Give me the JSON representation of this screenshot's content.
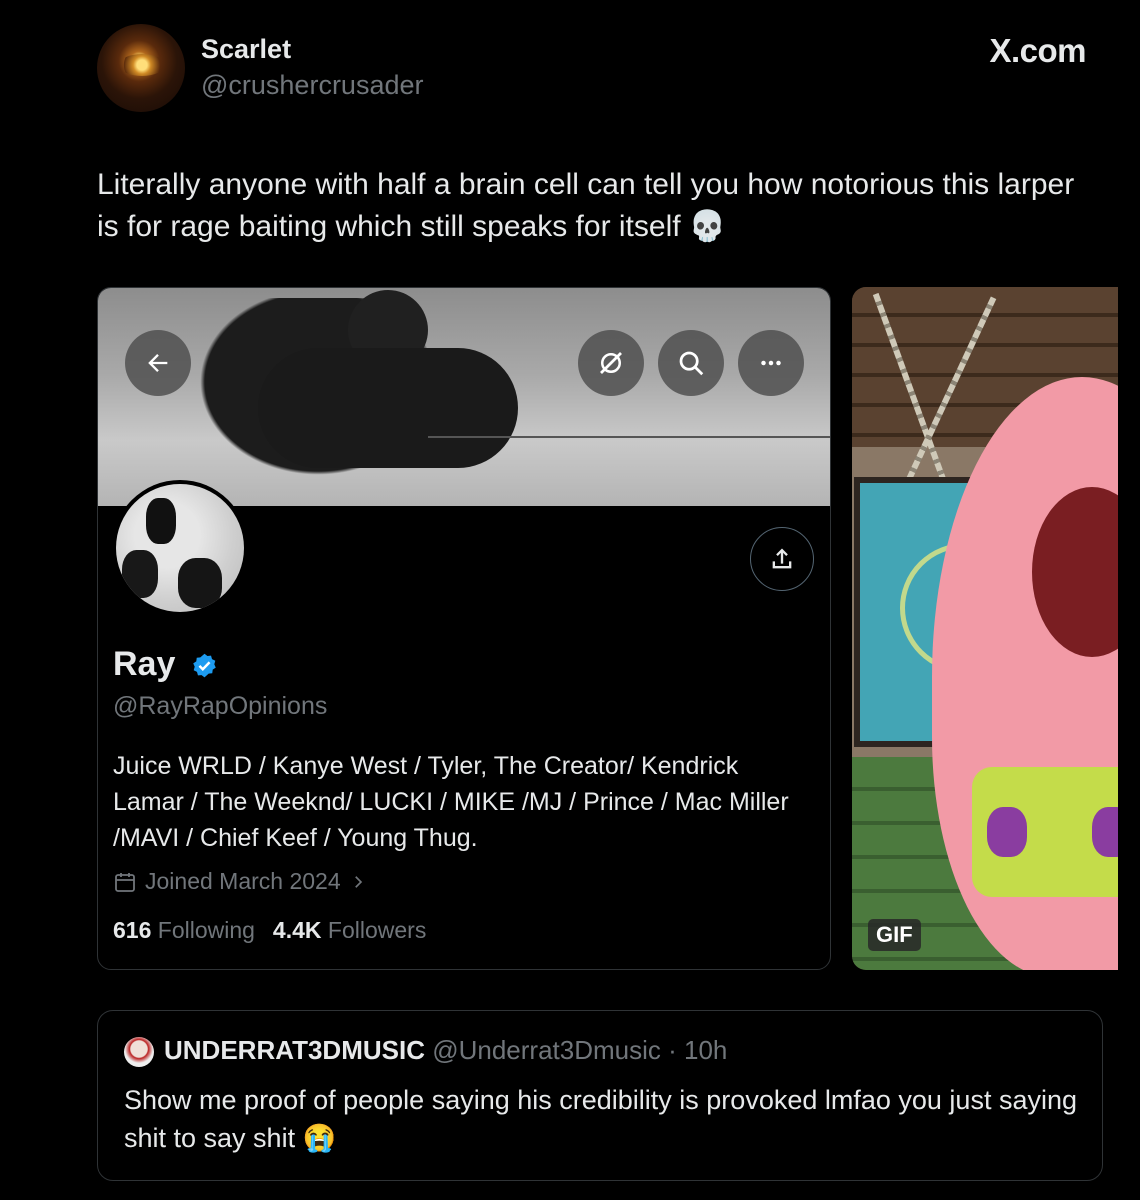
{
  "tweet": {
    "author_name": "Scarlet",
    "author_handle": "@crushercrusader",
    "watermark": "X.com",
    "text": "Literally anyone with half a brain cell can tell you how notorious this larper is for rage baiting which still speaks for itself 💀"
  },
  "profile_card": {
    "name": "Ray",
    "handle": "@RayRapOpinions",
    "bio": "Juice WRLD / Kanye West / Tyler, The Creator/ Kendrick Lamar / The Weeknd/ LUCKI / MIKE /MJ / Prince / Mac Miller /MAVI / Chief Keef / Young Thug.",
    "joined": "Joined March 2024",
    "following_count": "616",
    "following_label": "Following",
    "followers_count": "4.4K",
    "followers_label": "Followers"
  },
  "gif": {
    "badge": "GIF"
  },
  "quoted_tweet": {
    "name": "UNDERRAT3DMUSIC",
    "handle_time": "@Underrat3Dmusic · 10h",
    "text": "Show me proof of people saying his credibility is provoked lmfao you just saying shit to say shit 😭"
  },
  "colors": {
    "background": "#000000",
    "text": "#e7e9ea",
    "muted": "#71767b",
    "border": "#2f3336",
    "verified": "#1d9bf0"
  },
  "icons": [
    "back-arrow-icon",
    "grok-icon",
    "search-icon",
    "more-icon",
    "share-icon",
    "verified-badge-icon",
    "calendar-icon",
    "chevron-right-icon"
  ]
}
